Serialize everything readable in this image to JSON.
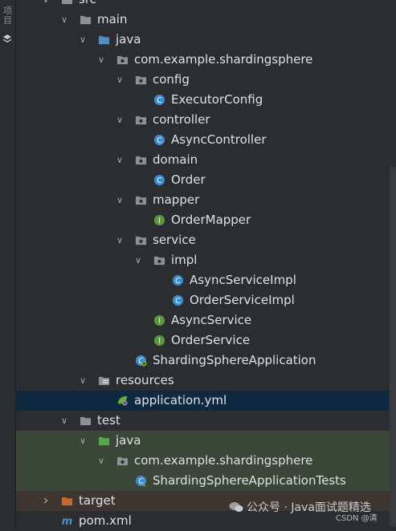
{
  "sidebar": {
    "tab_label": "项目"
  },
  "tree": [
    {
      "label": "src",
      "depth": 0,
      "arrow": "down",
      "icon": "folder-icon"
    },
    {
      "label": "main",
      "depth": 1,
      "arrow": "down",
      "icon": "folder-icon"
    },
    {
      "label": "java",
      "depth": 2,
      "arrow": "down",
      "icon": "source-folder-icon"
    },
    {
      "label": "com.example.shardingsphere",
      "depth": 3,
      "arrow": "down",
      "icon": "package-icon"
    },
    {
      "label": "config",
      "depth": 4,
      "arrow": "down",
      "icon": "package-icon"
    },
    {
      "label": "ExecutorConfig",
      "depth": 5,
      "arrow": "none",
      "icon": "class-icon"
    },
    {
      "label": "controller",
      "depth": 4,
      "arrow": "down",
      "icon": "package-icon"
    },
    {
      "label": "AsyncController",
      "depth": 5,
      "arrow": "none",
      "icon": "class-icon"
    },
    {
      "label": "domain",
      "depth": 4,
      "arrow": "down",
      "icon": "package-icon"
    },
    {
      "label": "Order",
      "depth": 5,
      "arrow": "none",
      "icon": "class-icon"
    },
    {
      "label": "mapper",
      "depth": 4,
      "arrow": "down",
      "icon": "package-icon"
    },
    {
      "label": "OrderMapper",
      "depth": 5,
      "arrow": "none",
      "icon": "interface-icon"
    },
    {
      "label": "service",
      "depth": 4,
      "arrow": "down",
      "icon": "package-icon"
    },
    {
      "label": "impl",
      "depth": 5,
      "arrow": "down",
      "icon": "package-icon"
    },
    {
      "label": "AsyncServiceImpl",
      "depth": 6,
      "arrow": "none",
      "icon": "class-icon"
    },
    {
      "label": "OrderServiceImpl",
      "depth": 6,
      "arrow": "none",
      "icon": "class-icon"
    },
    {
      "label": "AsyncService",
      "depth": 5,
      "arrow": "none",
      "icon": "interface-icon"
    },
    {
      "label": "OrderService",
      "depth": 5,
      "arrow": "none",
      "icon": "interface-icon"
    },
    {
      "label": "ShardingSphereApplication",
      "depth": 4,
      "arrow": "none",
      "icon": "spring-boot-app-icon"
    },
    {
      "label": "resources",
      "depth": 2,
      "arrow": "down",
      "icon": "resources-folder-icon"
    },
    {
      "label": "application.yml",
      "depth": 3,
      "arrow": "none",
      "icon": "spring-yml-icon",
      "selected": true
    },
    {
      "label": "test",
      "depth": 1,
      "arrow": "down",
      "icon": "folder-icon"
    },
    {
      "label": "java",
      "depth": 2,
      "arrow": "down",
      "icon": "test-folder-icon",
      "testbg": true
    },
    {
      "label": "com.example.shardingsphere",
      "depth": 3,
      "arrow": "down",
      "icon": "package-icon",
      "testbg": true
    },
    {
      "label": "ShardingSphereApplicationTests",
      "depth": 4,
      "arrow": "none",
      "icon": "test-class-icon",
      "testbg": true
    },
    {
      "label": "target",
      "depth": 0,
      "arrow": "right",
      "icon": "excluded-folder-icon",
      "targetbg": true
    },
    {
      "label": "pom.xml",
      "depth": 0,
      "arrow": "none",
      "icon": "maven-icon"
    }
  ],
  "watermark": {
    "text": "公众号 · Java面试题精选",
    "sub": "CSDN @清"
  },
  "colors": {
    "folder": "#8c9198",
    "source_folder": "#4a90c8",
    "test_folder": "#55a84a",
    "excluded_folder": "#c8682c",
    "class_icon": "#3d8ccf",
    "interface_icon": "#5a9a3d"
  }
}
